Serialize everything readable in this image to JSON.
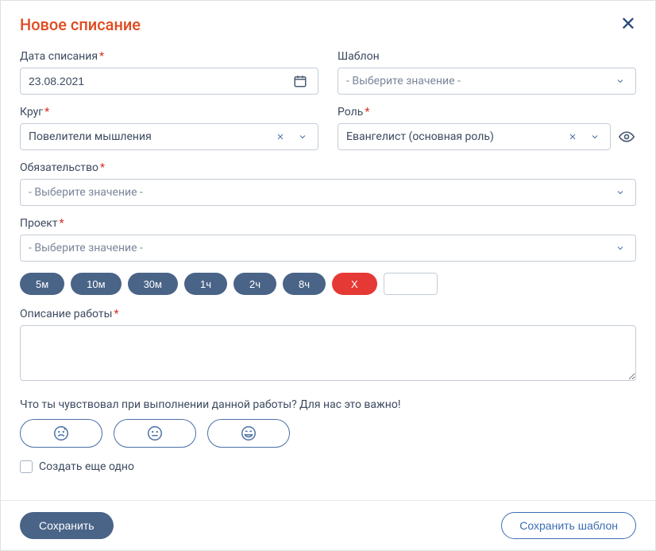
{
  "header": {
    "title": "Новое списание"
  },
  "fields": {
    "date": {
      "label": "Дата списания",
      "value": "23.08.2021",
      "required": true
    },
    "template": {
      "label": "Шаблон",
      "placeholder": "- Выберите значение -",
      "required": false
    },
    "circle": {
      "label": "Круг",
      "value": "Повелители мышления",
      "required": true
    },
    "role": {
      "label": "Роль",
      "value": "Евангелист (основная роль)",
      "required": true
    },
    "obligation": {
      "label": "Обязательство",
      "placeholder": "- Выберите значение -",
      "required": true
    },
    "project": {
      "label": "Проект",
      "placeholder": "- Выберите значение -",
      "required": true
    },
    "description": {
      "label": "Описание работы",
      "required": true
    }
  },
  "duration": {
    "pills": [
      "5м",
      "10м",
      "30м",
      "1ч",
      "2ч",
      "8ч"
    ],
    "clear": "X",
    "custom": ""
  },
  "feelings": {
    "prompt": "Что ты чувствовал при выполнении данной работы? Для нас это важно!"
  },
  "create_another": {
    "label": "Создать еще одно",
    "checked": false
  },
  "footer": {
    "save": "Сохранить",
    "save_template": "Сохранить шаблон"
  }
}
